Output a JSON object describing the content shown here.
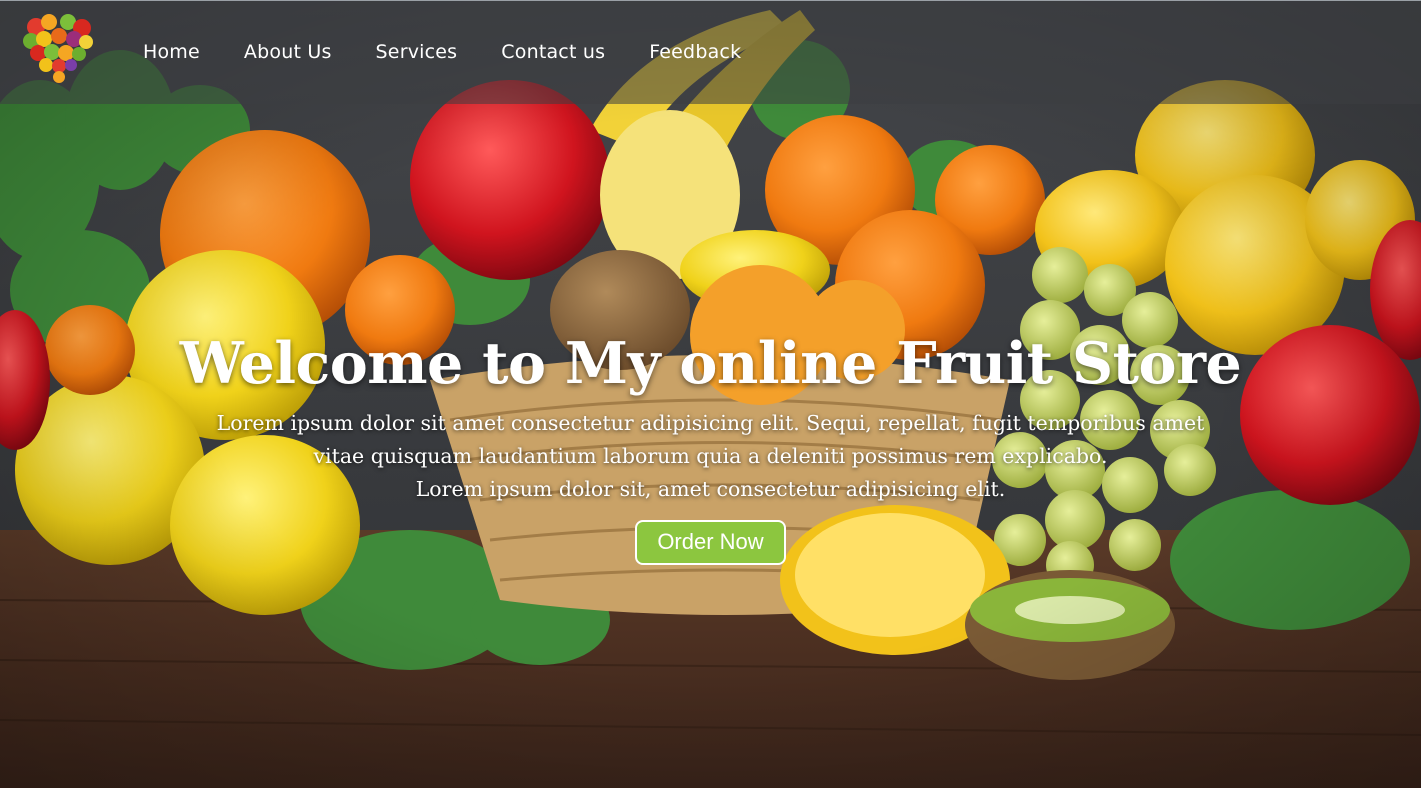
{
  "nav": {
    "logo_icon": "fruit-heart-logo-icon",
    "items": [
      {
        "label": "Home"
      },
      {
        "label": "About Us"
      },
      {
        "label": "Services"
      },
      {
        "label": "Contact us"
      },
      {
        "label": "Feedback"
      }
    ]
  },
  "hero": {
    "title": "Welcome to My online Fruit Store",
    "lines": [
      "Lorem ipsum dolor sit amet consectetur adipisicing elit. Sequi, repellat, fugit temporibus amet",
      "vitae quisquam laudantium laborum quia a deleniti possimus rem explicabo.",
      "Lorem ipsum dolor sit, amet consectetur adipisicing elit."
    ],
    "button_label": "Order Now"
  },
  "colors": {
    "button_bg": "#8cc63f",
    "nav_bg": "#3c3e42",
    "text": "#ffffff"
  }
}
